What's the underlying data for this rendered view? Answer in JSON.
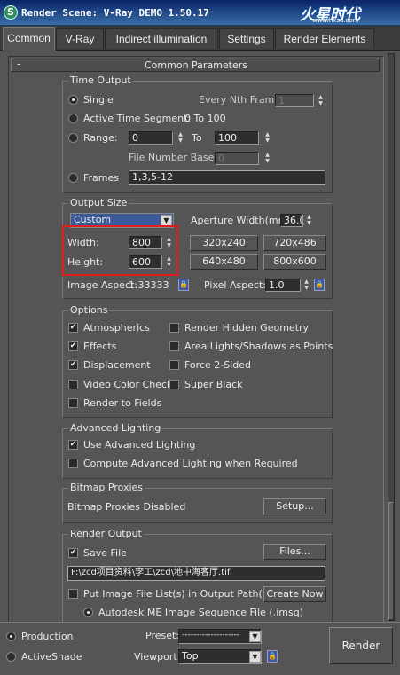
{
  "window": {
    "title": "Render Scene: V-Ray DEMO 1.50.17",
    "icon_letter": "S"
  },
  "watermark": {
    "logo": "火星时代",
    "url": "www.hxsd.com"
  },
  "tabs": [
    "Common",
    "V-Ray",
    "Indirect illumination",
    "Settings",
    "Render Elements"
  ],
  "active_tab": "Common",
  "rollout": {
    "title": "Common Parameters",
    "collapse": "-"
  },
  "time_output": {
    "title": "Time Output",
    "single_label": "Single",
    "every_nth_label": "Every Nth Frame:",
    "every_nth_value": "1",
    "active_segment_label": "Active Time Segment:",
    "active_segment_value": "0 To 100",
    "range_label": "Range:",
    "range_from": "0",
    "range_to_label": "To",
    "range_to": "100",
    "file_number_base_label": "File Number Base:",
    "file_number_base_value": "0",
    "frames_label": "Frames",
    "frames_value": "1,3,5-12",
    "selected": "Single"
  },
  "output_size": {
    "title": "Output Size",
    "preset": "Custom",
    "aperture_label": "Aperture Width(mm):",
    "aperture_value": "36.0",
    "width_label": "Width:",
    "width_value": "800",
    "height_label": "Height:",
    "height_value": "600",
    "presets": [
      "320x240",
      "720x486",
      "640x480",
      "800x600"
    ],
    "image_aspect_label": "Image Aspect:",
    "image_aspect_value": "1.33333",
    "pixel_aspect_label": "Pixel Aspect:",
    "pixel_aspect_value": "1.0"
  },
  "options": {
    "title": "Options",
    "left": [
      {
        "label": "Atmospherics",
        "checked": true
      },
      {
        "label": "Effects",
        "checked": true
      },
      {
        "label": "Displacement",
        "checked": true
      },
      {
        "label": "Video Color Check",
        "checked": false
      },
      {
        "label": "Render to Fields",
        "checked": false
      }
    ],
    "right": [
      {
        "label": "Render Hidden Geometry",
        "checked": false
      },
      {
        "label": "Area Lights/Shadows as Points",
        "checked": false
      },
      {
        "label": "Force 2-Sided",
        "checked": false
      },
      {
        "label": "Super Black",
        "checked": false
      }
    ]
  },
  "advanced_lighting": {
    "title": "Advanced Lighting",
    "use_label": "Use Advanced Lighting",
    "use_checked": true,
    "compute_label": "Compute Advanced Lighting when Required",
    "compute_checked": false
  },
  "bitmap_proxies": {
    "title": "Bitmap Proxies",
    "status": "Bitmap Proxies Disabled",
    "setup_label": "Setup..."
  },
  "render_output": {
    "title": "Render Output",
    "save_file_label": "Save File",
    "save_file_checked": true,
    "files_label": "Files...",
    "path": "F:\\zcd项目资料\\李工\\zcd\\地中海客厅.tif",
    "put_list_label": "Put Image File List(s) in Output Path(s)",
    "put_list_checked": false,
    "create_now_label": "Create Now",
    "sequence_label": "Autodesk ME Image Sequence File (.imsq)"
  },
  "bottom": {
    "production_label": "Production",
    "activeshade_label": "ActiveShade",
    "mode": "Production",
    "preset_label": "Preset:",
    "preset_value": "--------------------",
    "viewport_label": "Viewport:",
    "viewport_value": "Top",
    "render_label": "Render"
  },
  "colors": {
    "highlight_box": "#e31c1c",
    "panel": "#555555",
    "title_bar": "#0a246a"
  }
}
